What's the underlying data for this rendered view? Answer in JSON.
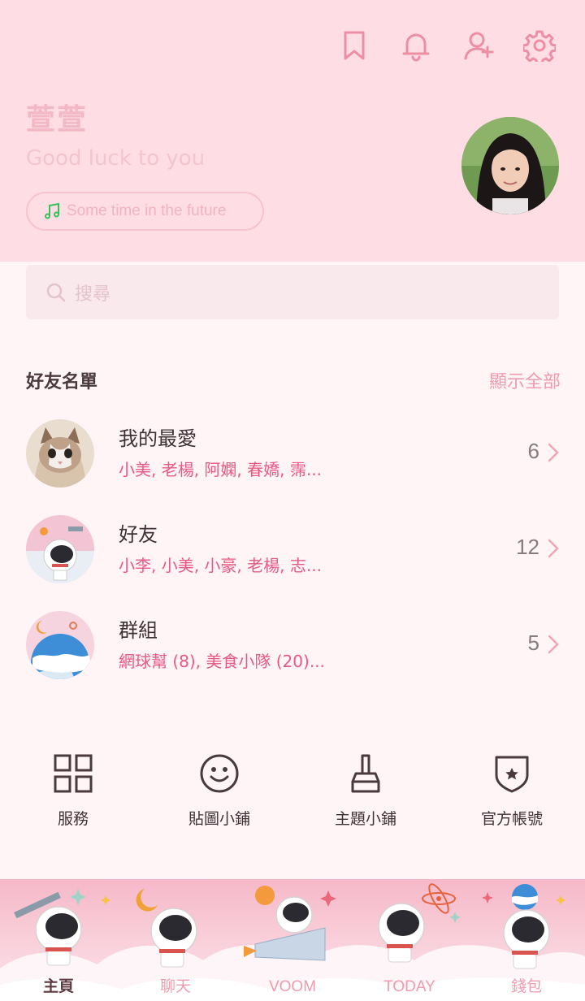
{
  "header": {
    "profile_name": "萱萱",
    "status_message": "Good luck to you",
    "music": "Some time in the future",
    "icons": [
      "bookmark-icon",
      "bell-icon",
      "add-friend-icon",
      "gear-icon"
    ]
  },
  "search": {
    "placeholder": "搜尋"
  },
  "friends_section": {
    "title": "好友名單",
    "show_all": "顯示全部",
    "items": [
      {
        "title": "我的最愛",
        "members": "小美, 老楊, 阿嫻, 春嬌, 霈...",
        "count": "6"
      },
      {
        "title": "好友",
        "members": "小李, 小美, 小豪, 老楊, 志...",
        "count": "12"
      },
      {
        "title": "群組",
        "members": "網球幫 (8), 美食小隊 (20)...",
        "count": "5"
      }
    ]
  },
  "services": [
    {
      "label": "服務",
      "icon": "grid-icon"
    },
    {
      "label": "貼圖小鋪",
      "icon": "smiley-icon"
    },
    {
      "label": "主題小鋪",
      "icon": "brush-icon"
    },
    {
      "label": "官方帳號",
      "icon": "shield-star-icon"
    }
  ],
  "tabs": [
    {
      "label": "主頁",
      "active": true
    },
    {
      "label": "聊天",
      "active": false
    },
    {
      "label": "VOOM",
      "active": false
    },
    {
      "label": "TODAY",
      "active": false
    },
    {
      "label": "錢包",
      "active": false
    }
  ],
  "colors": {
    "header_bg": "#ffdde4",
    "page_bg": "#fff4f6",
    "accent_pink": "#e85a86",
    "icon_pink": "#ec8ea4"
  }
}
